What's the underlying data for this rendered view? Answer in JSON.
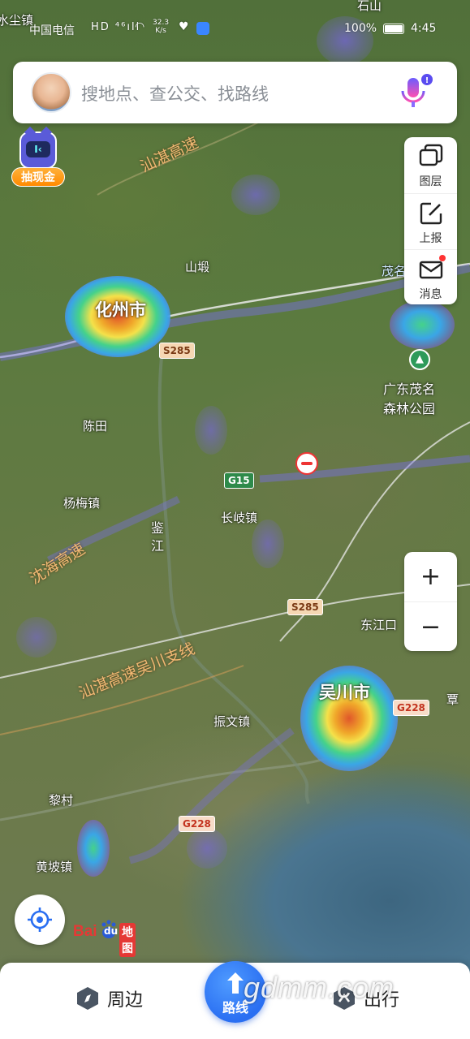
{
  "status_bar": {
    "carrier": "中国电信",
    "network_icons": "HD ⁴⁶ıll",
    "speed_value": "32.3",
    "speed_unit": "K/s",
    "battery": "100%",
    "time": "4:45"
  },
  "search": {
    "placeholder": "搜地点、查公交、找路线"
  },
  "cash_badge": {
    "face": "I‹",
    "label": "抽现金"
  },
  "tools": {
    "layers": "图层",
    "report": "上报",
    "messages": "消息"
  },
  "zoom": {
    "in": "+",
    "out": "−"
  },
  "map": {
    "labels": {
      "topleft_town": "水尘镇",
      "top_town": "石山",
      "shanpo": "山塅",
      "huazhou": "化州市",
      "chentian": "陈田",
      "yangmei": "杨梅镇",
      "jianjiang": "鉴\n江",
      "changqi": "长岐镇",
      "dongjiangkou": "东江口",
      "wuchuan": "吴川市",
      "zhenwen": "振文镇",
      "licun": "黎村",
      "huangpo": "黄坡镇",
      "maoming_edge": "茂名",
      "park": "广东茂名\n森林公园",
      "tan_edge": "覃"
    },
    "roads": {
      "shanzhan": "汕湛高速",
      "shenhai": "沈海高速",
      "shanzhan_branch": "汕湛高速吴川支线"
    },
    "shields": {
      "s285a": "S285",
      "s285b": "S285",
      "g15": "G15",
      "g228a": "G228",
      "g228b": "G228"
    }
  },
  "logo": {
    "bai": "Bai",
    "du": "du",
    "cn": "地图"
  },
  "bottom_bar": {
    "nearby": "周边",
    "route": "路线",
    "travel": "出行"
  },
  "watermark": "gdmm.com",
  "colors": {
    "accent": "#2a6ff2",
    "cash_orange": "#ff8a00",
    "notification_red": "#ff3333"
  }
}
